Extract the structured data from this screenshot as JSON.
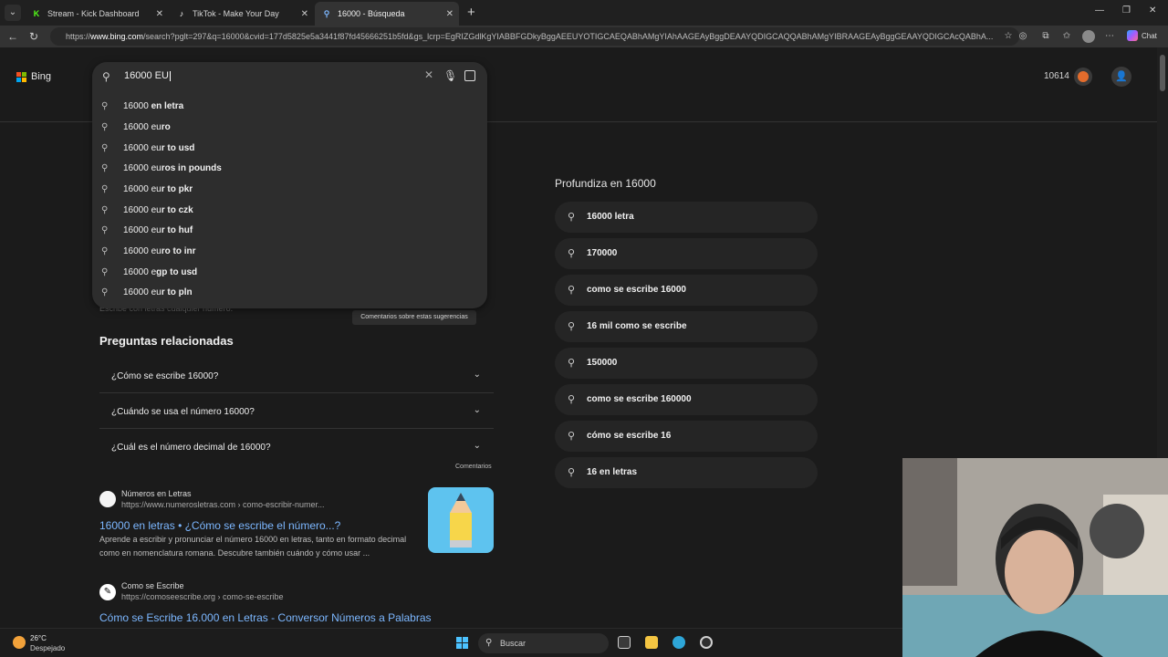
{
  "browser": {
    "tabs": [
      {
        "title": "Stream - Kick Dashboard",
        "fav": "K",
        "active": false
      },
      {
        "title": "TikTok - Make Your Day",
        "fav": "♪",
        "active": false
      },
      {
        "title": "16000 - Búsqueda",
        "fav": "⚲",
        "active": true
      }
    ],
    "url_prefix": "https://",
    "url_host": "www.bing.com",
    "url_rest": "/search?pglt=297&q=16000&cvid=177d5825e5a3441f87fd45666251b5fd&gs_lcrp=EgRIZGdlKgYIABBFGDkyBggAEEUYOTIGCAEQABhAMgYIAhAAGEAyBggDEAAYQDIGCAQQABhAMgYIBRAAGEAyBggGEAAYQDIGCAcQABhA...",
    "copilot_label": "Chat"
  },
  "bing": {
    "logo_text": "Bing",
    "rewards_points": "10614",
    "colors": {
      "ms_red": "#f25022",
      "ms_green": "#7fba00",
      "ms_blue": "#00a4ef",
      "ms_yellow": "#ffb900",
      "link": "#7cb7ff"
    }
  },
  "search": {
    "query": "16000 EU",
    "suggestions": [
      {
        "bold": "16000 ",
        "rest": "en letra",
        "bold2": ""
      },
      {
        "bold": "16000 ",
        "rest": "eu",
        "bold2": "ro"
      },
      {
        "bold": "16000 ",
        "rest": "eu",
        "bold2": "r to usd"
      },
      {
        "bold": "16000 ",
        "rest": "eu",
        "bold2": "ros in pounds"
      },
      {
        "bold": "16000 ",
        "rest": "eu",
        "bold2": "r to pkr"
      },
      {
        "bold": "16000 ",
        "rest": "eu",
        "bold2": "r to czk"
      },
      {
        "bold": "16000 ",
        "rest": "eu",
        "bold2": "r to huf"
      },
      {
        "bold": "16000 ",
        "rest": "eu",
        "bold2": "ro to inr"
      },
      {
        "bold": "16000 ",
        "rest": "e",
        "bold2": "gp to usd"
      },
      {
        "bold": "16000 ",
        "rest": "eu",
        "bold2": "r to pln"
      }
    ],
    "faded_text": "Escribe con letras cualquier número.",
    "feedback_label": "Comentarios sobre estas sugerencias"
  },
  "related": {
    "title": "Preguntas relacionadas",
    "questions": [
      "¿Cómo se escribe 16000?",
      "¿Cuándo se usa el número 16000?",
      "¿Cuál es el número decimal de 16000?"
    ],
    "comentarios": "Comentarios"
  },
  "results": [
    {
      "site": "Números en Letras",
      "url": "https://www.numerosletras.com › como-escribir-numer...",
      "title": "16000 en letras • ¿Cómo se escribe el número...?",
      "snippet": "Aprende a escribir y pronunciar el número 16000 en letras, tanto en formato decimal como en nomenclatura romana. Descubre también cuándo y cómo usar ..."
    },
    {
      "site": "Como se Escribe",
      "url": "https://comoseescribe.org › como-se-escribe",
      "title": "Cómo se Escribe 16.000 en Letras - Conversor Números a Palabras"
    }
  ],
  "deep_dive": {
    "title": "Profundiza en 16000",
    "items": [
      "16000 letra",
      "170000",
      "como se escribe 16000",
      "16 mil como se escribe",
      "150000",
      "como se escribe 160000",
      "cómo se escribe 16",
      "16 en letras"
    ]
  },
  "taskbar": {
    "temperature": "26°C",
    "weather": "Despejado",
    "search_placeholder": "Buscar"
  }
}
